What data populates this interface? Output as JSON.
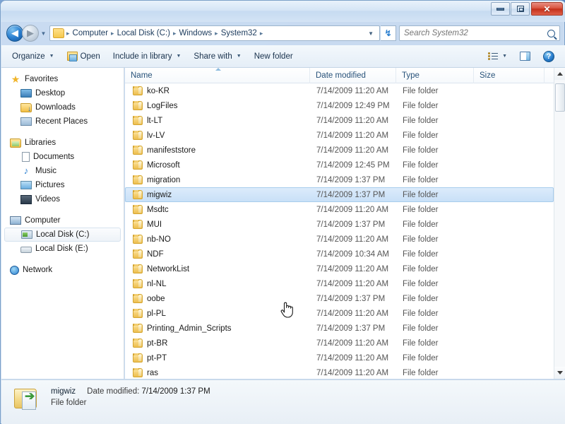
{
  "window": {
    "controls": {
      "minimize": "Minimize",
      "maximize": "Maximize",
      "close": "✕"
    }
  },
  "address": {
    "back_label": "◀",
    "forward_label": "▶",
    "history_caret": "▼",
    "folder_icon": "folder-icon",
    "crumbs": [
      "Computer",
      "Local Disk (C:)",
      "Windows",
      "System32"
    ],
    "separator": "▸",
    "dropdown_caret": "▼",
    "refresh_label": "↯"
  },
  "search": {
    "placeholder": "Search System32",
    "value": "",
    "icon": "search-icon"
  },
  "toolbar": {
    "organize": "Organize",
    "open": "Open",
    "include_in_library": "Include in library",
    "share_with": "Share with",
    "new_folder": "New folder",
    "caret": "▼",
    "views_icon": "view-options-icon",
    "preview_pane_icon": "preview-pane-icon",
    "help_icon": "help-icon",
    "help_glyph": "?"
  },
  "sidebar": {
    "groups": [
      {
        "header": {
          "label": "Favorites",
          "icon": "star-icon"
        },
        "items": [
          {
            "label": "Desktop",
            "icon": "desktop-icon"
          },
          {
            "label": "Downloads",
            "icon": "downloads-icon"
          },
          {
            "label": "Recent Places",
            "icon": "recent-places-icon"
          }
        ]
      },
      {
        "header": {
          "label": "Libraries",
          "icon": "libraries-icon"
        },
        "items": [
          {
            "label": "Documents",
            "icon": "documents-icon"
          },
          {
            "label": "Music",
            "icon": "music-icon"
          },
          {
            "label": "Pictures",
            "icon": "pictures-icon"
          },
          {
            "label": "Videos",
            "icon": "videos-icon"
          }
        ]
      },
      {
        "header": {
          "label": "Computer",
          "icon": "computer-icon"
        },
        "items": [
          {
            "label": "Local Disk (C:)",
            "icon": "hard-disk-icon",
            "selected": true
          },
          {
            "label": "Local Disk (E:)",
            "icon": "disk-drive-icon",
            "selected": false
          }
        ]
      },
      {
        "header": {
          "label": "Network",
          "icon": "network-icon"
        },
        "items": []
      }
    ]
  },
  "filelist": {
    "columns": [
      {
        "key": "name",
        "label": "Name",
        "sorted": true
      },
      {
        "key": "date",
        "label": "Date modified"
      },
      {
        "key": "type",
        "label": "Type"
      },
      {
        "key": "size",
        "label": "Size"
      }
    ],
    "rows": [
      {
        "name": "ko-KR",
        "date": "7/14/2009 11:20 AM",
        "type": "File folder",
        "size": "",
        "selected": false
      },
      {
        "name": "LogFiles",
        "date": "7/14/2009 12:49 PM",
        "type": "File folder",
        "size": "",
        "selected": false
      },
      {
        "name": "lt-LT",
        "date": "7/14/2009 11:20 AM",
        "type": "File folder",
        "size": "",
        "selected": false
      },
      {
        "name": "lv-LV",
        "date": "7/14/2009 11:20 AM",
        "type": "File folder",
        "size": "",
        "selected": false
      },
      {
        "name": "manifeststore",
        "date": "7/14/2009 11:20 AM",
        "type": "File folder",
        "size": "",
        "selected": false
      },
      {
        "name": "Microsoft",
        "date": "7/14/2009 12:45 PM",
        "type": "File folder",
        "size": "",
        "selected": false
      },
      {
        "name": "migration",
        "date": "7/14/2009 1:37 PM",
        "type": "File folder",
        "size": "",
        "selected": false
      },
      {
        "name": "migwiz",
        "date": "7/14/2009 1:37 PM",
        "type": "File folder",
        "size": "",
        "selected": true
      },
      {
        "name": "Msdtc",
        "date": "7/14/2009 11:20 AM",
        "type": "File folder",
        "size": "",
        "selected": false
      },
      {
        "name": "MUI",
        "date": "7/14/2009 1:37 PM",
        "type": "File folder",
        "size": "",
        "selected": false
      },
      {
        "name": "nb-NO",
        "date": "7/14/2009 11:20 AM",
        "type": "File folder",
        "size": "",
        "selected": false
      },
      {
        "name": "NDF",
        "date": "7/14/2009 10:34 AM",
        "type": "File folder",
        "size": "",
        "selected": false
      },
      {
        "name": "NetworkList",
        "date": "7/14/2009 11:20 AM",
        "type": "File folder",
        "size": "",
        "selected": false
      },
      {
        "name": "nl-NL",
        "date": "7/14/2009 11:20 AM",
        "type": "File folder",
        "size": "",
        "selected": false
      },
      {
        "name": "oobe",
        "date": "7/14/2009 1:37 PM",
        "type": "File folder",
        "size": "",
        "selected": false
      },
      {
        "name": "pl-PL",
        "date": "7/14/2009 11:20 AM",
        "type": "File folder",
        "size": "",
        "selected": false
      },
      {
        "name": "Printing_Admin_Scripts",
        "date": "7/14/2009 1:37 PM",
        "type": "File folder",
        "size": "",
        "selected": false
      },
      {
        "name": "pt-BR",
        "date": "7/14/2009 11:20 AM",
        "type": "File folder",
        "size": "",
        "selected": false
      },
      {
        "name": "pt-PT",
        "date": "7/14/2009 11:20 AM",
        "type": "File folder",
        "size": "",
        "selected": false
      },
      {
        "name": "ras",
        "date": "7/14/2009 11:20 AM",
        "type": "File folder",
        "size": "",
        "selected": false
      }
    ]
  },
  "scrollbar": {
    "up_arrow": "▲",
    "down_arrow": "▼"
  },
  "status": {
    "name": "migwiz",
    "date_label": "Date modified:",
    "date_value": "7/14/2009 1:37 PM",
    "type": "File folder",
    "icon": "folder-with-arrow-icon"
  },
  "colors": {
    "selection_fill": "#c9e0f7",
    "selection_border": "#a8cdec",
    "folder_yellow": "#f6d277",
    "close_red": "#c3301a",
    "aero_blue": "#cddef2"
  }
}
